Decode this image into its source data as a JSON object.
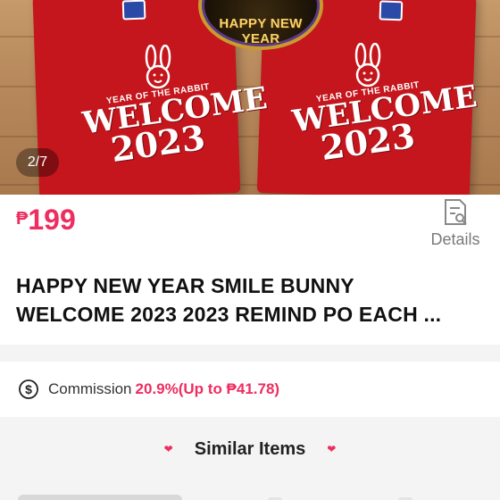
{
  "gallery": {
    "badge_text": "HAPPY NEW YEAR",
    "shirt_print": {
      "year_of_text": "YEAR OF THE RABBIT",
      "welcome_text": "WELCOME",
      "year_text": "2023"
    },
    "page_indicator": "2/7"
  },
  "product": {
    "currency": "₱",
    "price": "199",
    "details_label": "Details",
    "title_line1": "HAPPY NEW YEAR SMILE BUNNY",
    "title_line2": "WELCOME 2023 2023 REMIND PO EACH ..."
  },
  "commission": {
    "label": "Commission",
    "value": "20.9%(Up to ₱41.78)",
    "icon": "dollar-circle-icon"
  },
  "similar": {
    "label": "Similar Items"
  },
  "colors": {
    "accent": "#ee2d60",
    "shirt": "#c4161c"
  }
}
